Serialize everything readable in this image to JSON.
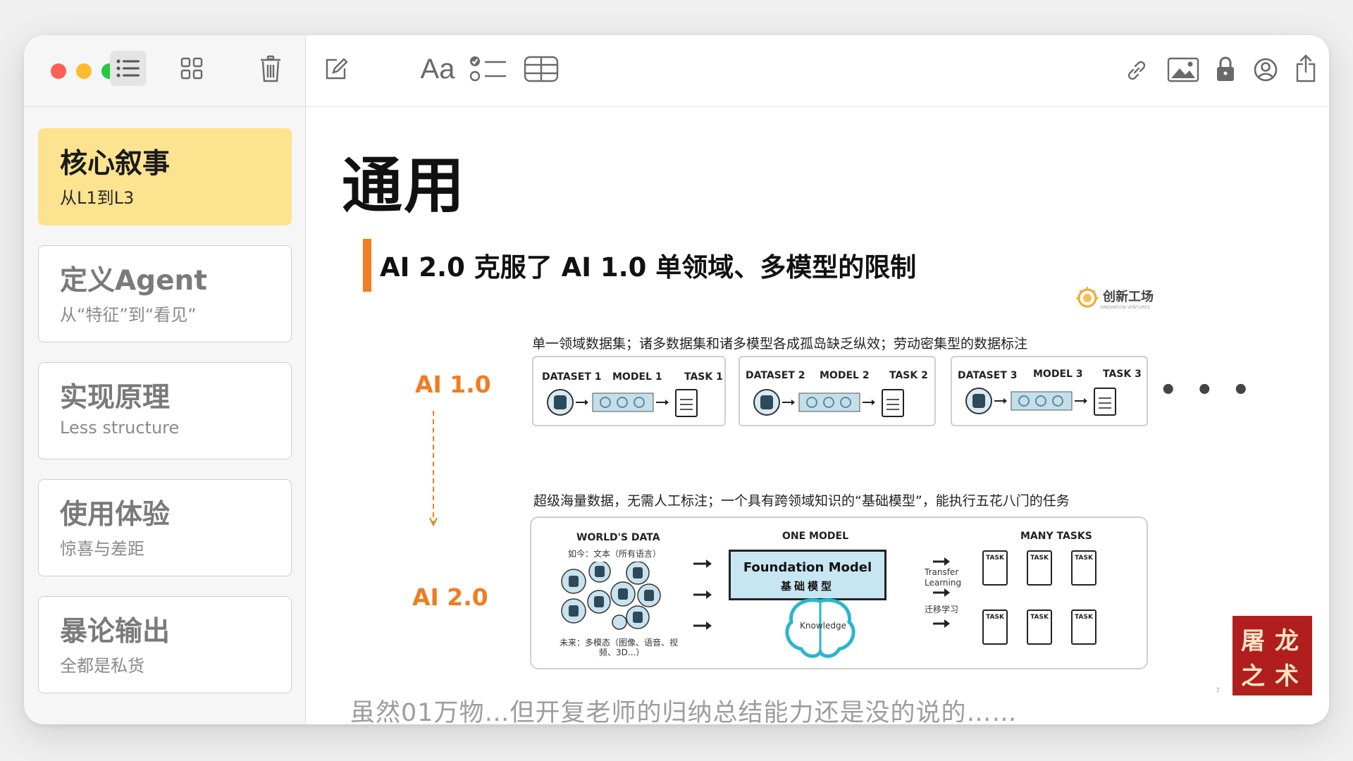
{
  "toolbar": {
    "font_button": "Aa",
    "icons": [
      "list-view-icon",
      "gallery-view-icon",
      "trash-icon",
      "compose-icon",
      "checklist-icon",
      "table-icon",
      "link-icon",
      "media-icon",
      "lock-icon",
      "collaborate-icon",
      "share-icon"
    ]
  },
  "sidebar": {
    "notes": [
      {
        "title": "核心叙事",
        "subtitle": "从L1到L3",
        "selected": true
      },
      {
        "title": "定义Agent",
        "subtitle": "从“特征”到“看见”",
        "selected": false
      },
      {
        "title": "实现原理",
        "subtitle": "Less structure",
        "selected": false
      },
      {
        "title": "使用体验",
        "subtitle": "惊喜与差距",
        "selected": false
      },
      {
        "title": "暴论输出",
        "subtitle": "全都是私货",
        "selected": false
      }
    ]
  },
  "note": {
    "title": "通用",
    "caption": "虽然01万物…但开复老师的归纳总结能力还是没的说的……"
  },
  "slide": {
    "title": "AI 2.0 克服了 AI 1.0 单领域、多模型的限制",
    "logo_text": "创新工场",
    "logo_sub": "SINOVATION VENTURES",
    "ai1_label": "AI 1.0",
    "ai2_label": "AI 2.0",
    "ai1_caption": "单一领域数据集；诸多数据集和诸多模型各成孤岛缺乏纵效；劳动密集型的数据标注",
    "ai2_caption": "超级海量数据，无需人工标注；一个具有跨领域知识的“基础模型”，能执行五花八门的任务",
    "pipelines": [
      {
        "dataset": "DATASET 1",
        "model": "MODEL 1",
        "task": "TASK 1"
      },
      {
        "dataset": "DATASET 2",
        "model": "MODEL 2",
        "task": "TASK 2"
      },
      {
        "dataset": "DATASET 3",
        "model": "MODEL 3",
        "task": "TASK 3"
      }
    ],
    "ellipsis": "• • •",
    "worlds_data": "WORLD'S DATA",
    "worlds_now": "如今：文本（所有语言）",
    "worlds_future_1": "未来：多模态（图像、语音、视",
    "worlds_future_2": "频、3D...）",
    "one_model": "ONE MODEL",
    "foundation_en": "Foundation Model",
    "foundation_cn": "基础模型",
    "knowledge": "Knowledge",
    "transfer_1": "Transfer",
    "transfer_2": "Learning",
    "transfer_cn": "迁移学习",
    "many_tasks": "MANY TASKS",
    "task_word": "TASK",
    "page_number": "7"
  },
  "stamp": {
    "chars": [
      "屠",
      "龙",
      "之",
      "术"
    ]
  }
}
